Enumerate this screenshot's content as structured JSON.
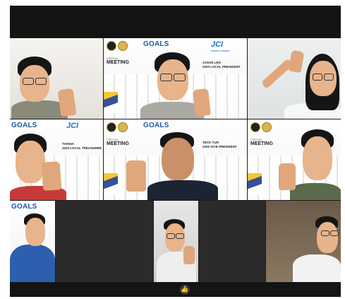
{
  "sdg_prefix": "SUSTAINABLE DEVELOPMENT",
  "sdg_word": "GOALS",
  "jci": "JCI",
  "jci_sub": "Kuala Lumpur",
  "virtual": "VIRTUAL",
  "meeting": "MEETING",
  "tiles": {
    "jason": {
      "name": "JASON LEN",
      "role": "2020 LOCAL PRESIDENT"
    },
    "tianna": {
      "name": "TIANNA",
      "role": "2020 LOCAL TREASURER"
    },
    "teck_yun": {
      "name": "TECK YUN",
      "role": "2020 VICE PRESIDENT"
    }
  },
  "reaction_icon": "thumbs-up-icon",
  "colors": {
    "active_speaker": "#9ccb3b",
    "sdg_blue": "#1e56a0",
    "jci_blue": "#1d6fd1"
  }
}
